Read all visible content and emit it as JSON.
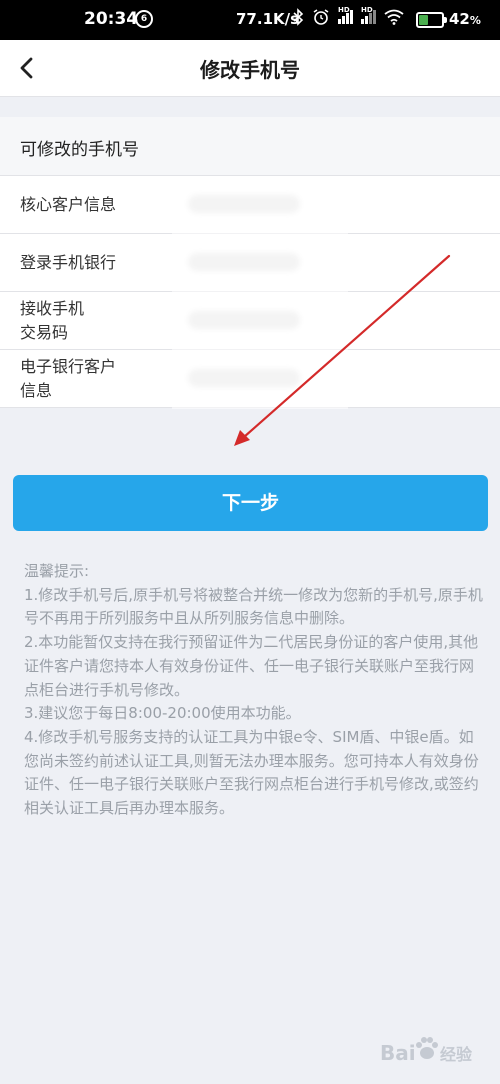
{
  "status_bar": {
    "time": "20:34",
    "app_icon_glyph": "6",
    "net_speed": "77.1K/s",
    "battery_percent": "42",
    "battery_level": 0.42,
    "battery_color": "#4caf50",
    "icons": [
      "bluetooth-icon",
      "alarm-icon",
      "signal-hd-icon",
      "signal-hd-icon",
      "wifi-icon",
      "battery-charging-icon"
    ],
    "hd_label": "HD"
  },
  "header": {
    "title": "修改手机号",
    "back_icon": "chevron-left-icon"
  },
  "section": {
    "title": "可修改的手机号"
  },
  "rows": [
    {
      "label_lines": [
        "核心客户信息"
      ]
    },
    {
      "label_lines": [
        "登录手机银行"
      ]
    },
    {
      "label_lines": [
        "接收手机",
        "交易码"
      ]
    },
    {
      "label_lines": [
        "电子银行客户",
        "信息"
      ]
    }
  ],
  "next_button": {
    "label": "下一步",
    "color": "#26a6ea"
  },
  "tips": {
    "heading": "温馨提示:",
    "lines": [
      "1.修改手机号后,原手机号将被整合并统一修改为您新的手机号,原手机号不再用于所列服务中且从所列服务信息中删除。",
      "2.本功能暂仅支持在我行预留证件为二代居民身份证的客户使用,其他证件客户请您持本人有效身份证件、任一电子银行关联账户至我行网点柜台进行手机号修改。",
      "3.建议您于每日8:00-20:00使用本功能。",
      "4.修改手机号服务支持的认证工具为中银e令、SIM盾、中银e盾。如您尚未签约前述认证工具,则暂无法办理本服务。您可持本人有效身份证件、任一电子银行关联账户至我行网点柜台进行手机号修改,或签约相关认证工具后再办理本服务。"
    ]
  },
  "annotation": {
    "arrow_color": "#d42a2a"
  },
  "watermark": {
    "text_left": "Bai",
    "text_right": "经验"
  }
}
